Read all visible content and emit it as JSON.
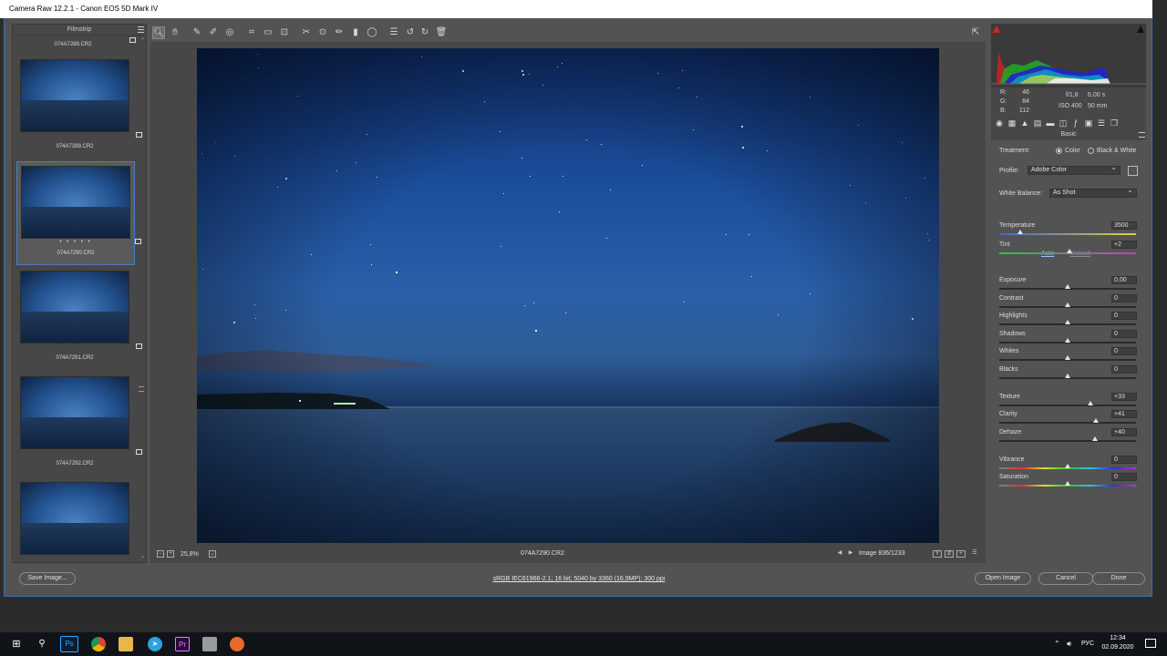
{
  "window": {
    "title": "Camera Raw 12.2.1  -  Canon EOS 5D Mark IV"
  },
  "filmstrip": {
    "title": "Filmstrip",
    "top_name": "074A7288.CR2",
    "items": [
      {
        "name": "074A7289.CR2",
        "selected": false
      },
      {
        "name": "074A7290.CR2",
        "selected": true,
        "rating": "• • • • •"
      },
      {
        "name": "074A7291.CR2",
        "selected": false
      },
      {
        "name": "074A7292.CR2",
        "selected": false
      },
      {
        "name": "",
        "selected": false
      }
    ]
  },
  "toolbar": {
    "tools": [
      "zoom-tool",
      "hand-tool",
      "white-balance-tool",
      "color-sampler-tool",
      "targeted-adjustment-tool",
      "crop-tool",
      "straighten-tool",
      "transform-tool",
      "spot-removal-tool",
      "red-eye-tool",
      "adjustment-brush-tool",
      "graduated-filter-tool",
      "radial-filter-tool",
      "open-preferences-tool",
      "rotate-left-tool",
      "rotate-right-tool",
      "trash-tool"
    ],
    "active_tool": "zoom-tool"
  },
  "preview": {
    "zoom": "25,8%",
    "filename": "074A7290.CR2",
    "image_counter": "Image 836/1233"
  },
  "info": {
    "r_label": "R:",
    "r": "46",
    "g_label": "G:",
    "g": "84",
    "b_label": "B:",
    "b": "112",
    "aperture": "f/1,8",
    "shutter": "6,00 s",
    "iso": "ISO 400",
    "focal": "50 mm"
  },
  "panel": {
    "title": "Basic",
    "treatment_label": "Treatment:",
    "treatment_color": "Color",
    "treatment_bw": "Black & White",
    "profile_label": "Profile:",
    "profile_value": "Adobe Color",
    "wb_label": "White Balance:",
    "wb_value": "As Shot",
    "auto": "Auto",
    "default": "Default",
    "sliders": [
      {
        "label": "Temperature",
        "value": "3500",
        "pos": 0.15,
        "track": "temp"
      },
      {
        "label": "Tint",
        "value": "+2",
        "pos": 0.51,
        "track": "tint"
      },
      {
        "label": "Exposure",
        "value": "0,00",
        "pos": 0.5,
        "track": "plain"
      },
      {
        "label": "Contrast",
        "value": "0",
        "pos": 0.5,
        "track": "plain"
      },
      {
        "label": "Highlights",
        "value": "0",
        "pos": 0.5,
        "track": "plain"
      },
      {
        "label": "Shadows",
        "value": "0",
        "pos": 0.5,
        "track": "plain"
      },
      {
        "label": "Whites",
        "value": "0",
        "pos": 0.5,
        "track": "plain"
      },
      {
        "label": "Blacks",
        "value": "0",
        "pos": 0.5,
        "track": "plain"
      },
      {
        "label": "Texture",
        "value": "+33",
        "pos": 0.665,
        "track": "plain"
      },
      {
        "label": "Clarity",
        "value": "+41",
        "pos": 0.705,
        "track": "plain"
      },
      {
        "label": "Dehaze",
        "value": "+40",
        "pos": 0.7,
        "track": "plain"
      },
      {
        "label": "Vibrance",
        "value": "0",
        "pos": 0.5,
        "track": "sat"
      },
      {
        "label": "Saturation",
        "value": "0",
        "pos": 0.5,
        "track": "sat"
      }
    ]
  },
  "footer": {
    "save": "Save Image...",
    "meta": "sRGB IEC61966-2.1; 16 bit; 5040 by 3360 (16,9MP); 300 ppi",
    "open": "Open Image",
    "cancel": "Cancel",
    "done": "Done"
  },
  "taskbar": {
    "lang": "РУС",
    "time": "12:34",
    "date": "02.09.2020",
    "apps": [
      "windows-start",
      "search",
      "photoshop",
      "chrome",
      "file-explorer",
      "telegram",
      "premiere",
      "app",
      "app2"
    ]
  },
  "colors": {
    "accent": "#3a6db5",
    "panel": "#535353",
    "dark": "#474747"
  }
}
